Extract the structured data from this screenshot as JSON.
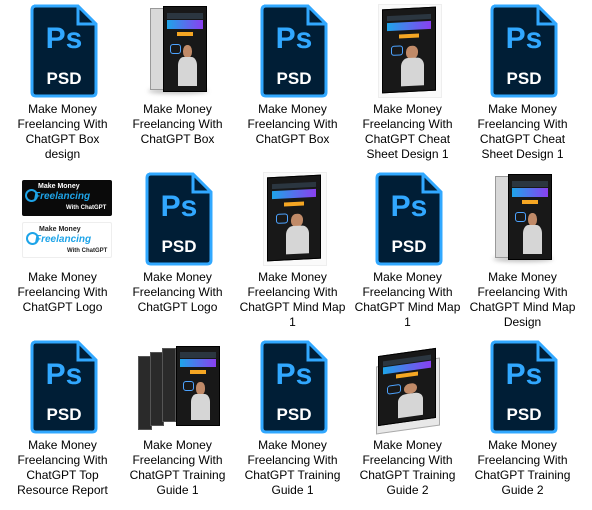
{
  "files": [
    {
      "name": "Make Money Freelancing With ChatGPT Box design",
      "type": "psd"
    },
    {
      "name": "Make Money Freelancing With ChatGPT Box",
      "type": "box"
    },
    {
      "name": "Make Money Freelancing With ChatGPT Box",
      "type": "psd"
    },
    {
      "name": "Make Money Freelancing With ChatGPT Cheat Sheet Design 1",
      "type": "book"
    },
    {
      "name": "Make Money Freelancing With ChatGPT Cheat Sheet Design 1",
      "type": "psd"
    },
    {
      "name": "Make Money Freelancing With ChatGPT Logo",
      "type": "logo"
    },
    {
      "name": "Make Money Freelancing With ChatGPT Logo",
      "type": "psd"
    },
    {
      "name": "Make Money Freelancing With ChatGPT Mind Map 1",
      "type": "book"
    },
    {
      "name": "Make Money Freelancing With ChatGPT Mind Map 1",
      "type": "psd"
    },
    {
      "name": "Make Money Freelancing With ChatGPT Mind Map Design",
      "type": "box"
    },
    {
      "name": "Make Money Freelancing With ChatGPT Top Resource Report",
      "type": "psd"
    },
    {
      "name": "Make Money Freelancing With ChatGPT Training Guide 1",
      "type": "bundle"
    },
    {
      "name": "Make Money Freelancing With ChatGPT Training Guide 1",
      "type": "psd"
    },
    {
      "name": "Make Money Freelancing With ChatGPT Training Guide 2",
      "type": "openbook"
    },
    {
      "name": "Make Money Freelancing With ChatGPT Training Guide 2",
      "type": "psd"
    }
  ],
  "psd_icon": {
    "glyph": "Ps",
    "caption": "PSD",
    "color_bg": "#001e36",
    "color_accent": "#31a8ff"
  },
  "logo": {
    "line1": "Make Money",
    "line2": "Freelancing",
    "line3": "With ChatGPT"
  },
  "colors": {
    "background": "#ffffff",
    "text": "#000000"
  }
}
